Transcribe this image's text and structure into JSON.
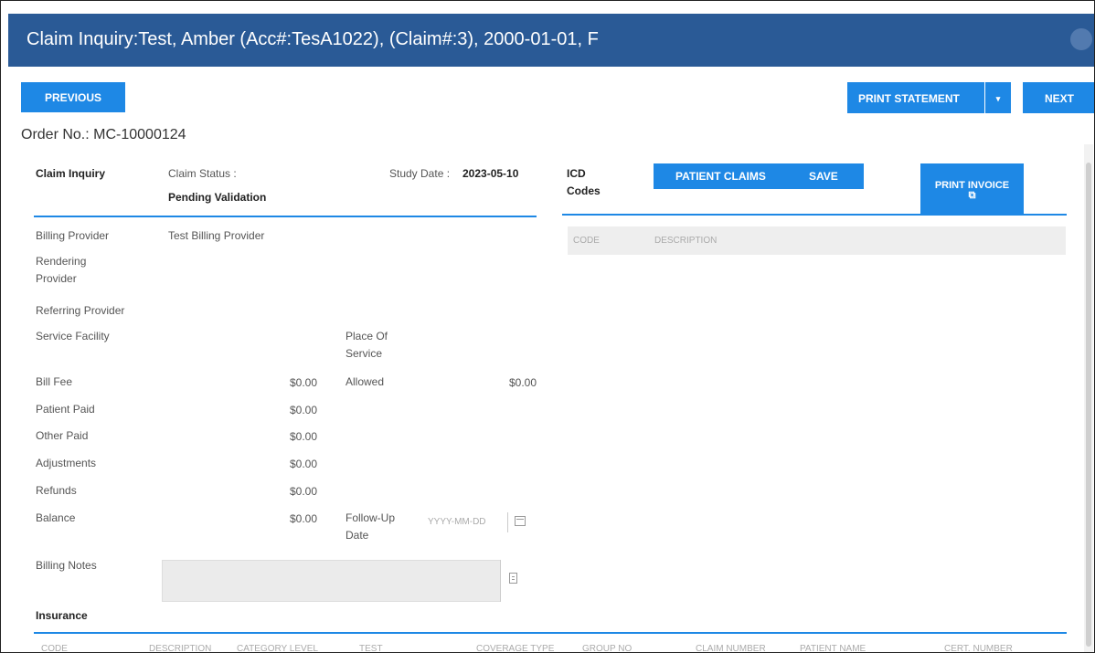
{
  "header": {
    "title": "Claim Inquiry:Test, Amber (Acc#:TesA1022), (Claim#:3), 2000-01-01, F"
  },
  "toolbar": {
    "previous_label": "PREVIOUS",
    "print_statement_label": "PRINT STATEMENT",
    "caret_icon": "▾",
    "next_label": "NEXT"
  },
  "order": {
    "text": "Order No.: MC-10000124"
  },
  "claim": {
    "section_label": "Claim Inquiry",
    "status_label": "Claim Status :",
    "status_value": "Pending Validation",
    "study_date_label": "Study Date :",
    "study_date_value": "2023-05-10",
    "billing_provider_label": "Billing Provider",
    "billing_provider_value": "Test Billing Provider",
    "rendering_provider_label": "Rendering Provider",
    "referring_provider_label": "Referring Provider",
    "service_facility_label": "Service Facility",
    "place_of_service_label": "Place Of Service"
  },
  "fees": {
    "bill_fee_label": "Bill Fee",
    "bill_fee_value": "$0.00",
    "allowed_label": "Allowed",
    "allowed_value": "$0.00",
    "patient_paid_label": "Patient Paid",
    "patient_paid_value": "$0.00",
    "other_paid_label": "Other Paid",
    "other_paid_value": "$0.00",
    "adjustments_label": "Adjustments",
    "adjustments_value": "$0.00",
    "refunds_label": "Refunds",
    "refunds_value": "$0.00",
    "balance_label": "Balance",
    "balance_value": "$0.00",
    "followup_label": "Follow-Up Date",
    "followup_placeholder": "YYYY-MM-DD"
  },
  "notes": {
    "label": "Billing Notes"
  },
  "icd": {
    "label": "ICD Codes",
    "patient_claims_label": "PATIENT CLAIMS",
    "save_label": "SAVE",
    "print_invoice_label": "PRINT INVOICE",
    "col_code": "CODE",
    "col_description": "DESCRIPTION"
  },
  "insurance": {
    "label": "Insurance",
    "faded_columns": [
      "CODE",
      "DESCRIPTION",
      "CATEGORY LEVEL",
      "TEST",
      "COVERAGE TYPE",
      "GROUP NO",
      "CLAIM NUMBER",
      "PATIENT NAME",
      "CERT. NUMBER"
    ]
  },
  "colors": {
    "title_bar": "#2a5a96",
    "accent": "#1e88e5"
  }
}
